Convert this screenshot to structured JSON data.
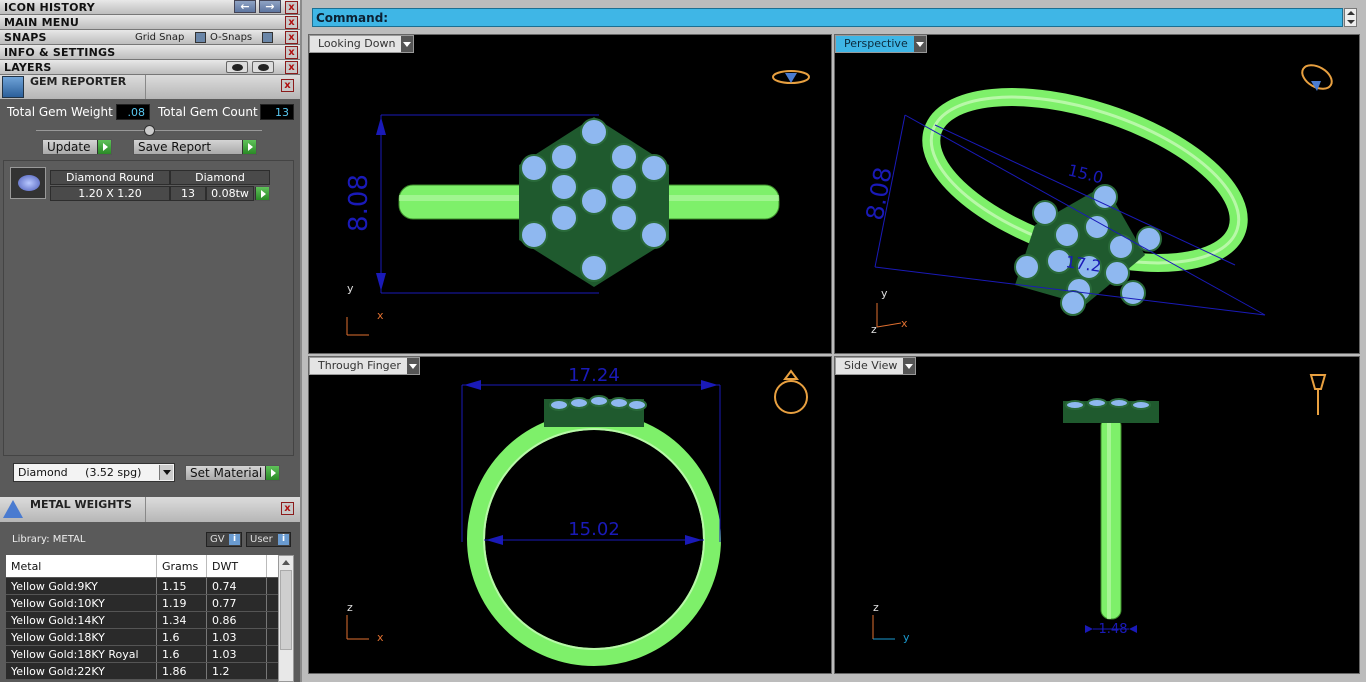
{
  "panels": {
    "icon_history": "ICON HISTORY",
    "main_menu": "MAIN MENU",
    "snaps": "SNAPS",
    "grid_snap": "Grid Snap",
    "o_snaps": "O-Snaps",
    "info_settings": "INFO & SETTINGS",
    "layers": "LAYERS",
    "close_glyph": "x",
    "back_arrow": "←",
    "forward_arrow": "→"
  },
  "gem_reporter": {
    "title": "GEM REPORTER",
    "total_weight_label": "Total Gem Weight",
    "total_weight_value": ".08",
    "total_count_label": "Total Gem Count",
    "total_count_value": "13",
    "update_label": "Update",
    "save_report_label": "Save Report",
    "gem": {
      "shape": "Diamond Round",
      "material": "Diamond",
      "size": "1.20 X 1.20",
      "count": "13",
      "weight": "0.08tw"
    },
    "material_select": "Diamond     (3.52 spg)",
    "set_material_label": "Set Material"
  },
  "metal_weights": {
    "title": "METAL WEIGHTS",
    "library_label": "Library: METAL",
    "gv_label": "GV",
    "user_label": "User",
    "info_glyph": "i",
    "columns": [
      "Metal",
      "Grams",
      "DWT"
    ],
    "rows": [
      [
        "Yellow Gold:9KY",
        "1.15",
        "0.74"
      ],
      [
        "Yellow Gold:10KY",
        "1.19",
        "0.77"
      ],
      [
        "Yellow Gold:14KY",
        "1.34",
        "0.86"
      ],
      [
        "Yellow Gold:18KY",
        "1.6",
        "1.03"
      ],
      [
        "Yellow Gold:18KY Royal",
        "1.6",
        "1.03"
      ],
      [
        "Yellow Gold:22KY",
        "1.86",
        "1.2"
      ]
    ]
  },
  "command": {
    "label": "Command:"
  },
  "viewports": [
    {
      "name": "Looking Down",
      "dimension": "8.08",
      "axis_a": "y",
      "axis_b": "x"
    },
    {
      "name": "Perspective",
      "dimension": "8.08",
      "dimension2": "15.0",
      "dimension3": "17.2",
      "axis_a": "y",
      "axis_b": "z",
      "axis_c": "x"
    },
    {
      "name": "Through Finger",
      "dimension": "17.24",
      "dimension2": "15.02",
      "axis_a": "z",
      "axis_b": "x"
    },
    {
      "name": "Side View",
      "dimension": "1.48",
      "axis_a": "z",
      "axis_b": "y"
    }
  ],
  "colors": {
    "metal_green": "#7ef06a",
    "gem_blue": "#8fb8f0",
    "dimension_blue": "#1a1ab8",
    "command_bar": "#3fb6e6",
    "axis_orange": "#e07030"
  }
}
